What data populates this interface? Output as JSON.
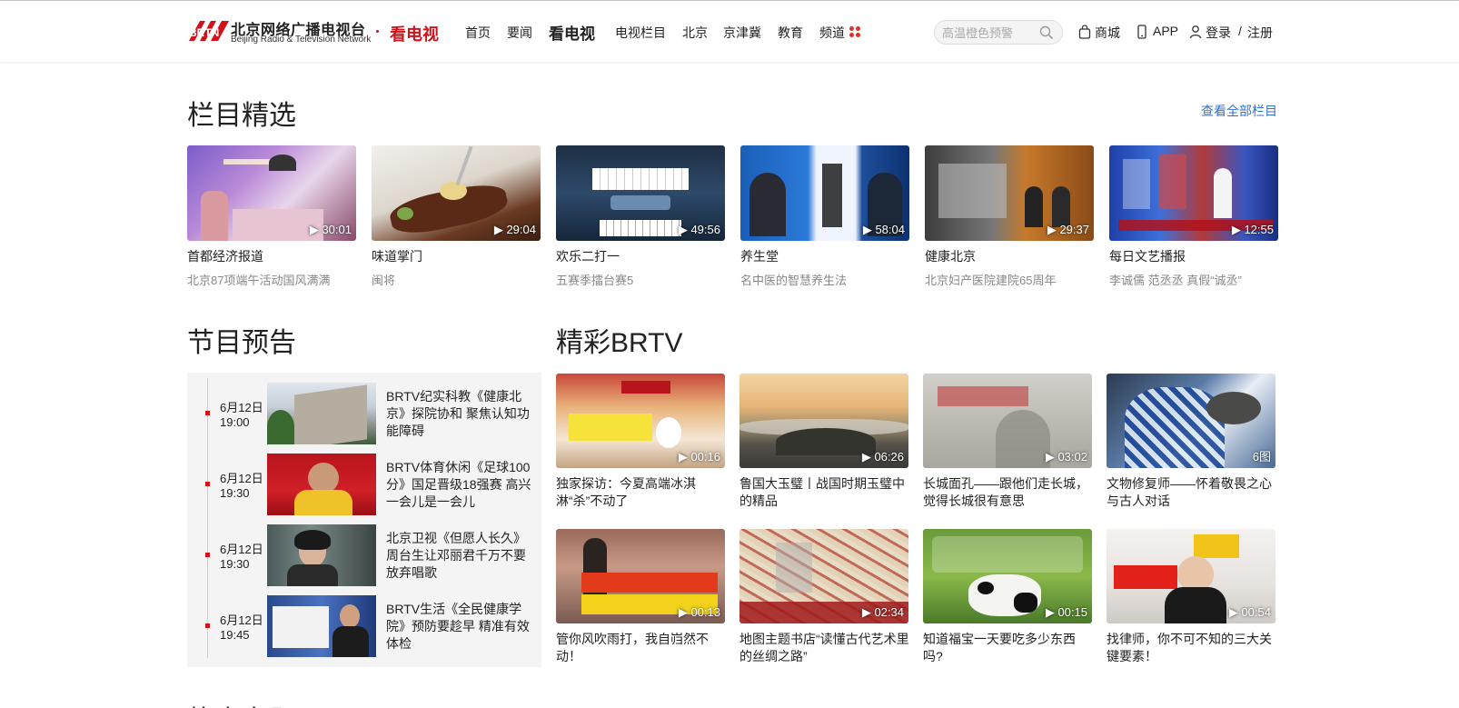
{
  "header": {
    "logo_cn": "北京网络广播电视台",
    "logo_en": "Beijing Radio & Television Network",
    "logo_badge": "BRTN",
    "section_name": "看电视",
    "nav": [
      "首页",
      "要闻",
      "看电视",
      "电视栏目",
      "北京",
      "京津冀",
      "教育",
      "频道"
    ],
    "search_placeholder": "高温橙色预警",
    "shop": "商城",
    "app": "APP",
    "login": "登录",
    "separator": "/",
    "register": "注册",
    "accent_color": "#d0121b"
  },
  "featured": {
    "title": "栏目精选",
    "view_all": "查看全部栏目",
    "items": [
      {
        "title": "首都经济报道",
        "sub": "北京87项端午活动国风满满",
        "duration": "30:01"
      },
      {
        "title": "味道掌门",
        "sub": "闽将",
        "duration": "29:04"
      },
      {
        "title": "欢乐二打一",
        "sub": "五赛季擂台赛5",
        "duration": "49:56"
      },
      {
        "title": "养生堂",
        "sub": "名中医的智慧养生法",
        "duration": "58:04"
      },
      {
        "title": "健康北京",
        "sub": "北京妇产医院建院65周年",
        "duration": "29:37"
      },
      {
        "title": "每日文艺播报",
        "sub": "李诚儒 范丞丞 真假“诚丞”",
        "duration": "12:55"
      }
    ]
  },
  "schedule": {
    "title": "节目预告",
    "items": [
      {
        "date": "6月12日",
        "time": "19:00",
        "text": "BRTV纪实科教《健康北京》探院协和 聚焦认知功能障碍"
      },
      {
        "date": "6月12日",
        "time": "19:30",
        "text": "BRTV体育休闲《足球100分》国足晋级18强赛 高兴一会儿是一会儿"
      },
      {
        "date": "6月12日",
        "time": "19:30",
        "text": "北京卫视《但愿人长久》周台生让邓丽君千万不要放弃唱歌"
      },
      {
        "date": "6月12日",
        "time": "19:45",
        "text": "BRTV生活《全民健康学院》预防要趁早 精准有效体检"
      }
    ]
  },
  "brtv": {
    "title": "精彩BRTV",
    "items": [
      {
        "text": "独家探访：今夏高端冰淇淋“杀”不动了",
        "duration": "00:16"
      },
      {
        "text": "鲁国大玉璧丨战国时期玉璧中的精品",
        "duration": "06:26"
      },
      {
        "text": "长城面孔——跟他们走长城，觉得长城很有意思",
        "duration": "03:02"
      },
      {
        "text": "文物修复师——怀着敬畏之心与古人对话",
        "duration": "6图"
      },
      {
        "text": "管你风吹雨打，我自岿然不动！",
        "duration": "00:13"
      },
      {
        "text": "地图主题书店“读懂古代艺术里的丝绸之路”",
        "duration": "02:34"
      },
      {
        "text": "知道福宝一天要吃多少东西吗?",
        "duration": "00:15"
      },
      {
        "text": "找律师，你不可不知的三大关键要素！",
        "duration": "00:54"
      }
    ]
  },
  "next_section_title": "热点专题"
}
